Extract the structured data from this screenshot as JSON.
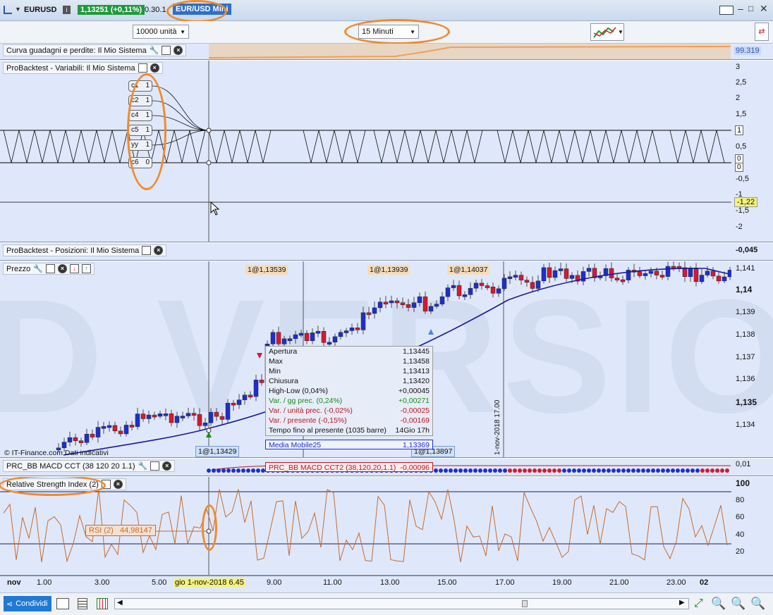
{
  "titlebar": {
    "symbol": "EURUSD",
    "price": "1,13251 (+0,11%)",
    "time": "0.30.1",
    "instrument_name": "EUR/USD Mini"
  },
  "toolbar": {
    "units": "10000 unità",
    "timeframe": "15 Minuti"
  },
  "panels": {
    "equity": {
      "title": "Curva guadagni e perdite: Il Mio Sistema",
      "value": "99.319"
    },
    "variables": {
      "title": "ProBacktest - Variabili: Il Mio Sistema",
      "vars": [
        {
          "name": "c1",
          "value": "1"
        },
        {
          "name": "c2",
          "value": "1"
        },
        {
          "name": "c4",
          "value": "1"
        },
        {
          "name": "c5",
          "value": "1"
        },
        {
          "name": "yy",
          "value": "1"
        },
        {
          "name": "c6",
          "value": "0"
        }
      ],
      "yticks": [
        "3",
        "2,5",
        "2",
        "1,5",
        "0,5",
        "-0,5",
        "-1",
        "-1,5",
        "-2"
      ],
      "ylabels": {
        "one": "1",
        "zero_a": "0",
        "zero_b": "0",
        "cursor": "-1,22"
      }
    },
    "positions": {
      "title": "ProBacktest - Posizioni: Il Mio Sistema",
      "value": "-0,045"
    },
    "price": {
      "title": "Prezzo",
      "yticks": [
        "1,141",
        "1,14",
        "1,139",
        "1,138",
        "1,137",
        "1,136",
        "1,135",
        "1,134"
      ],
      "tags": [
        "1@1,13539",
        "1@1,13939",
        "1@1,14037",
        "1@1,13429",
        "1@1,13897"
      ],
      "credit": "© IT-Finance.com Dati indicativi",
      "vline_label": "1-nov-2018 17.00",
      "watermark": "D VERSIO",
      "tooltip": {
        "rows": [
          {
            "label": "Apertura",
            "value": "1,13445",
            "color": "#111111"
          },
          {
            "label": "Max",
            "value": "1,13458",
            "color": "#111111"
          },
          {
            "label": "Min",
            "value": "1,13413",
            "color": "#111111"
          },
          {
            "label": "Chiusura",
            "value": "1,13420",
            "color": "#111111"
          },
          {
            "label": "High-Low (0,04%)",
            "value": "+0,00045",
            "color": "#111111"
          },
          {
            "label": "Var. / gg prec. (0,24%)",
            "value": "+0,00271",
            "color": "#1a8a1a"
          },
          {
            "label": "Var. / unità prec. (-0,02%)",
            "value": "-0,00025",
            "color": "#c0141e"
          },
          {
            "label": "Var. / presente (-0,15%)",
            "value": "-0,00169",
            "color": "#c0141e"
          },
          {
            "label": "Tempo fino al presente (1035 barre)",
            "value": "14Gio 17h",
            "color": "#111111"
          }
        ],
        "ma_label": "Media Mobile25",
        "ma_value": "1,13369",
        "macd_label": "PRC_BB MACD CCT2 (38,120,20,1.1)",
        "macd_value": "-0,00096"
      }
    },
    "macd": {
      "title": "PRC_BB MACD CCT (38 120 20 1.1)",
      "value": "0,01"
    },
    "rsi": {
      "title": "Relative Strength Index (2)",
      "yticks": [
        "100",
        "80",
        "60",
        "40",
        "20"
      ],
      "readout_label": "RSI (2)",
      "readout_value": "44,98147"
    }
  },
  "xaxis": {
    "labels": [
      "nov",
      "1.00",
      "3.00",
      "5.00",
      "9.00",
      "11.00",
      "13.00",
      "15.00",
      "17.00",
      "19.00",
      "21.00",
      "23.00",
      "02"
    ],
    "cursor_label": "gio 1-nov-2018 6.45"
  },
  "statusbar": {
    "share_label": "Condividi"
  },
  "colors": {
    "panel_bg": "#dfe8fb",
    "bull": "#1c2fd0",
    "bear": "#d81830",
    "rsi_line": "#c86a2a",
    "highlight": "#f08a2c"
  }
}
